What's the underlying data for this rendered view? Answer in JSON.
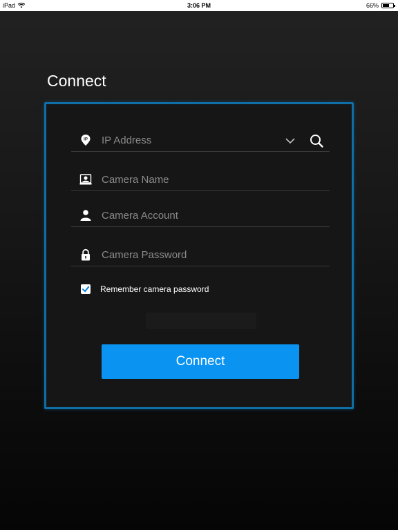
{
  "status_bar": {
    "device": "iPad",
    "time": "3:06 PM",
    "battery": "66%",
    "battery_level": 0.66
  },
  "page": {
    "title": "Connect"
  },
  "form": {
    "ip_address": {
      "placeholder": "IP Address",
      "value": ""
    },
    "camera_name": {
      "placeholder": "Camera Name",
      "value": ""
    },
    "camera_account": {
      "placeholder": "Camera Account",
      "value": ""
    },
    "camera_password": {
      "placeholder": "Camera Password",
      "value": ""
    },
    "remember": {
      "label": "Remember camera password",
      "checked": true
    },
    "connect_label": "Connect"
  },
  "icons": {
    "ip": "ip-pin-icon",
    "name": "camera-icon",
    "account": "user-icon",
    "password": "lock-icon",
    "dropdown": "chevron-down-icon",
    "search": "search-icon"
  },
  "colors": {
    "accent": "#0a93f0",
    "panel_border": "#0e6fa6",
    "background": "#161616"
  }
}
